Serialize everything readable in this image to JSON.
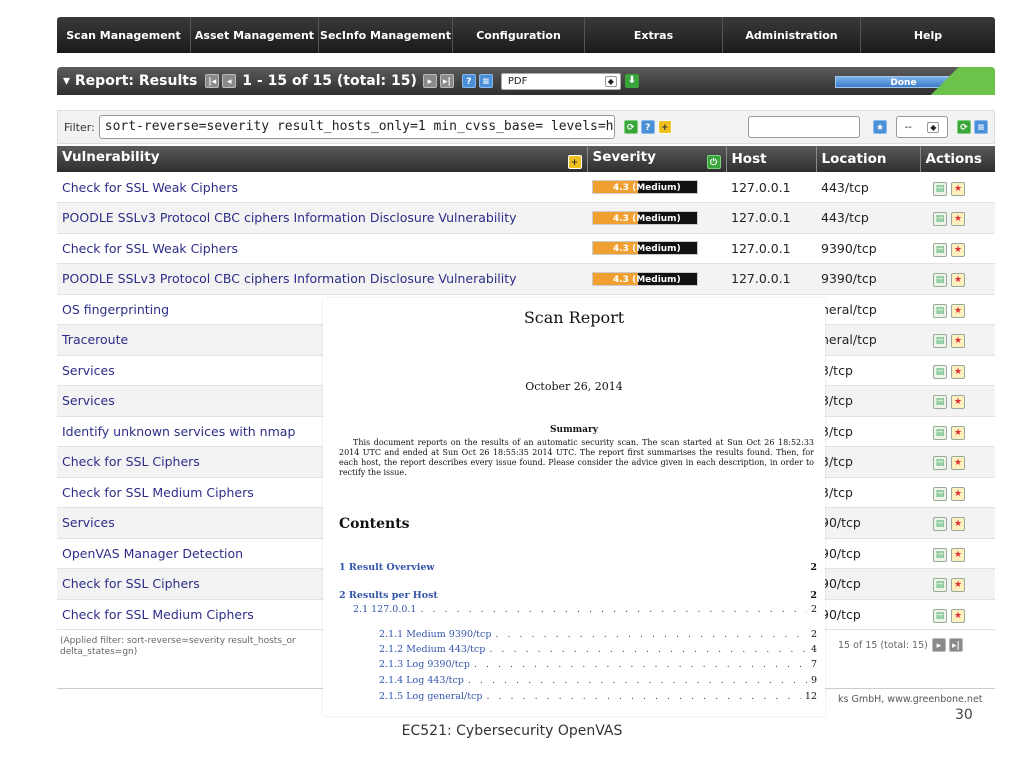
{
  "nav": [
    "Scan Management",
    "Asset Management",
    "SecInfo Management",
    "Configuration",
    "Extras",
    "Administration",
    "Help"
  ],
  "report": {
    "title": "▾ Report: Results",
    "pager": "1 - 15 of 15 (total: 15)",
    "format": "PDF",
    "status": "Done"
  },
  "filter": {
    "label": "Filter:",
    "value": "sort-reverse=severity result_hosts_only=1 min_cvss_base= levels=hmlg",
    "select_value": "--"
  },
  "table": {
    "headers": [
      "Vulnerability",
      "Severity",
      "Host",
      "Location",
      "Actions"
    ],
    "rows": [
      {
        "vuln": "Check for SSL Weak Ciphers",
        "sev": "4.3 (Medium)",
        "host": "127.0.0.1",
        "loc": "443/tcp"
      },
      {
        "vuln": "POODLE SSLv3 Protocol CBC ciphers Information Disclosure Vulnerability",
        "sev": "4.3 (Medium)",
        "host": "127.0.0.1",
        "loc": "443/tcp"
      },
      {
        "vuln": "Check for SSL Weak Ciphers",
        "sev": "4.3 (Medium)",
        "host": "127.0.0.1",
        "loc": "9390/tcp"
      },
      {
        "vuln": "POODLE SSLv3 Protocol CBC ciphers Information Disclosure Vulnerability",
        "sev": "4.3 (Medium)",
        "host": "127.0.0.1",
        "loc": "9390/tcp"
      },
      {
        "vuln": "OS fingerprinting",
        "sev": "",
        "host": "",
        "loc": "neral/tcp"
      },
      {
        "vuln": "Traceroute",
        "sev": "",
        "host": "",
        "loc": "neral/tcp"
      },
      {
        "vuln": "Services",
        "sev": "",
        "host": "",
        "loc": "3/tcp"
      },
      {
        "vuln": "Services",
        "sev": "",
        "host": "",
        "loc": "3/tcp"
      },
      {
        "vuln": "Identify unknown services with nmap",
        "sev": "",
        "host": "",
        "loc": "3/tcp"
      },
      {
        "vuln": "Check for SSL Ciphers",
        "sev": "",
        "host": "",
        "loc": "3/tcp"
      },
      {
        "vuln": "Check for SSL Medium Ciphers",
        "sev": "",
        "host": "",
        "loc": "3/tcp"
      },
      {
        "vuln": "Services",
        "sev": "",
        "host": "",
        "loc": "90/tcp"
      },
      {
        "vuln": "OpenVAS Manager Detection",
        "sev": "",
        "host": "",
        "loc": "90/tcp"
      },
      {
        "vuln": "Check for SSL Ciphers",
        "sev": "",
        "host": "",
        "loc": "90/tcp"
      },
      {
        "vuln": "Check for SSL Medium Ciphers",
        "sev": "",
        "host": "",
        "loc": "90/tcp"
      }
    ]
  },
  "applied_filter": "(Applied filter: sort-reverse=severity result_hosts_or delta_states=gn)",
  "footer_pager": "15 of 15 (total: 15)",
  "copyright": "ks GmbH, www.greenbone.net",
  "slide_number": "30",
  "caption": "EC521: Cybersecurity OpenVAS",
  "pdf": {
    "title": "Scan Report",
    "date": "October 26, 2014",
    "summary_heading": "Summary",
    "summary": "This document reports on the results of an automatic security scan. The scan started at Sun Oct 26 18:52:33 2014 UTC and ended at Sun Oct 26 18:55:35 2014 UTC. The report first summarises the results found. Then, for each host, the report describes every issue found. Please consider the advice given in each description, in order to rectify the issue.",
    "contents_heading": "Contents",
    "toc": [
      {
        "label": "1   Result Overview",
        "page": "2"
      },
      {
        "label": "2   Results per Host",
        "page": "2"
      },
      {
        "label": "2.1   127.0.0.1",
        "page": "2"
      },
      {
        "label": "2.1.1   Medium 9390/tcp",
        "page": "2"
      },
      {
        "label": "2.1.2   Medium 443/tcp",
        "page": "4"
      },
      {
        "label": "2.1.3   Log 9390/tcp",
        "page": "7"
      },
      {
        "label": "2.1.4   Log 443/tcp",
        "page": "9"
      },
      {
        "label": "2.1.5   Log general/tcp",
        "page": "12"
      }
    ]
  }
}
